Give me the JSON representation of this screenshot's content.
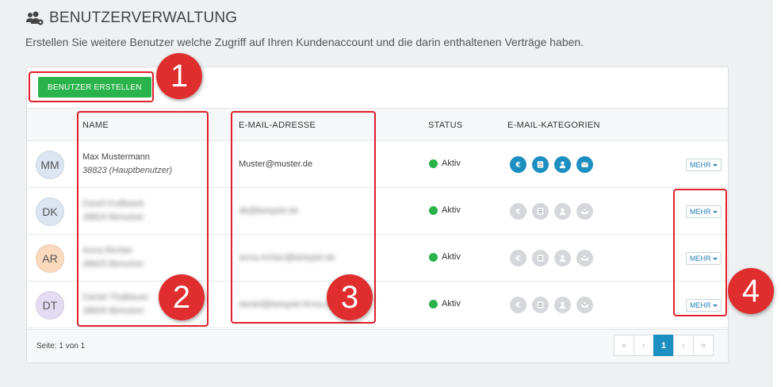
{
  "header": {
    "title": "BENUTZERVERWALTUNG",
    "description": "Erstellen Sie weitere Benutzer welche Zugriff auf Ihren Kundenaccount und die darin enthaltenen Verträge haben."
  },
  "toolbar": {
    "create_label": "BENUTZER ERSTELLEN"
  },
  "table": {
    "columns": {
      "name": "NAME",
      "email": "E-MAIL-ADRESSE",
      "status": "STATUS",
      "categories": "E-MAIL-KATEGORIEN"
    },
    "rows": [
      {
        "initials": "MM",
        "avatar_color": "#dbe6f2",
        "name": "Max Mustermann",
        "sub_id": "38823",
        "sub_role": "(Hauptbenutzer)",
        "email": "Muster@muster.de",
        "status": "Aktiv",
        "categories_active": true,
        "more_label": "MEHR"
      },
      {
        "initials": "DK",
        "avatar_color": "#dbe6f2",
        "name": "David Kraftwerk",
        "sub_id": "38824 Benutzer",
        "sub_role": "",
        "email": "dk@beispiel.de",
        "status": "Aktiv",
        "categories_active": false,
        "more_label": "MEHR"
      },
      {
        "initials": "AR",
        "avatar_color": "#fbd9bd",
        "name": "Anna Richter",
        "sub_id": "38825 Benutzer",
        "sub_role": "",
        "email": "anna.richter@beispiel.de",
        "status": "Aktiv",
        "categories_active": false,
        "more_label": "MEHR"
      },
      {
        "initials": "DT",
        "avatar_color": "#e3dcf2",
        "name": "Daniel Thalbauer",
        "sub_id": "38826 Benutzer",
        "sub_role": "",
        "email": "daniel@beispiel-firma.de",
        "status": "Aktiv",
        "categories_active": false,
        "more_label": "MEHR"
      }
    ]
  },
  "category_icons": [
    "euro-icon",
    "document-icon",
    "person-icon",
    "envelope-icon"
  ],
  "colors": {
    "accent": "#1a8fc0",
    "success": "#2ab34a",
    "inactive_icon": "#d5d7da",
    "annotation": "#e02d2d"
  },
  "footer": {
    "page_info": "Seite: 1 von 1",
    "pager": {
      "first": "«",
      "prev": "‹",
      "current": "1",
      "next": "›",
      "last": "»"
    }
  },
  "annotations": [
    "1",
    "2",
    "3",
    "4"
  ]
}
